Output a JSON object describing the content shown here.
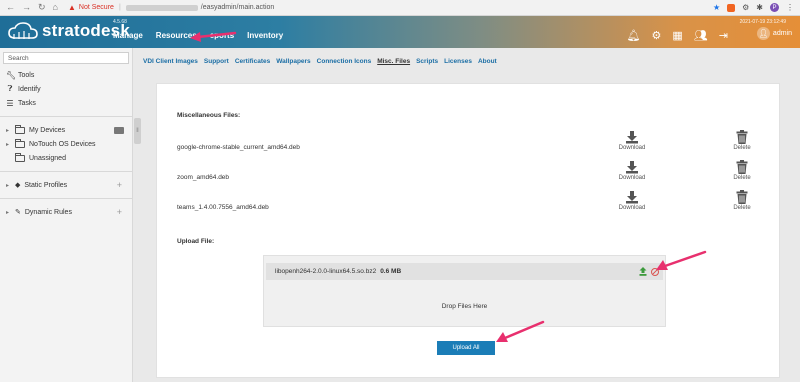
{
  "browser": {
    "not_secure": "Not Secure",
    "url_path": "/easyadmin/main.action"
  },
  "header": {
    "brand": "stratodesk",
    "version": "4.5.68",
    "nav": [
      "Manage",
      "Resources",
      "eports",
      "Inventory"
    ],
    "timestamp": "2021-07-19 23:12:49",
    "user": "admin"
  },
  "sidebar": {
    "search_placeholder": "Search",
    "tools": [
      {
        "label": "Tools",
        "icon": "wrench-icon"
      },
      {
        "label": "Identify",
        "icon": "help-circle-icon"
      },
      {
        "label": "Tasks",
        "icon": "task-list-icon"
      }
    ],
    "devices": [
      {
        "label": "My Devices"
      },
      {
        "label": "NoTouch OS Devices"
      },
      {
        "label": "Unassigned"
      }
    ],
    "static_profiles": "Static Profiles",
    "dynamic_rules": "Dynamic Rules"
  },
  "tabs": [
    "VDI Client Images",
    "Support",
    "Certificates",
    "Wallpapers",
    "Connection Icons",
    "Misc. Files",
    "Scripts",
    "Licenses",
    "About"
  ],
  "active_tab": "Misc. Files",
  "misc": {
    "title": "Miscellaneous Files:",
    "download_label": "Download",
    "delete_label": "Delete",
    "files": [
      "google-chrome-stable_current_amd64.deb",
      "zoom_amd64.deb",
      "teams_1.4.00.7556_amd64.deb"
    ]
  },
  "upload": {
    "title": "Upload File:",
    "file_name": "libopenh264-2.0.0-linux64.5.so.bz2",
    "file_size": "0.6 MB",
    "drop_text": "Drop Files Here",
    "button": "Upload All"
  },
  "colors": {
    "brand_blue": "#1f6e98",
    "brand_orange": "#e58f38",
    "link": "#1b6ea5",
    "button": "#1b7db7",
    "annotation": "#e8306e"
  }
}
